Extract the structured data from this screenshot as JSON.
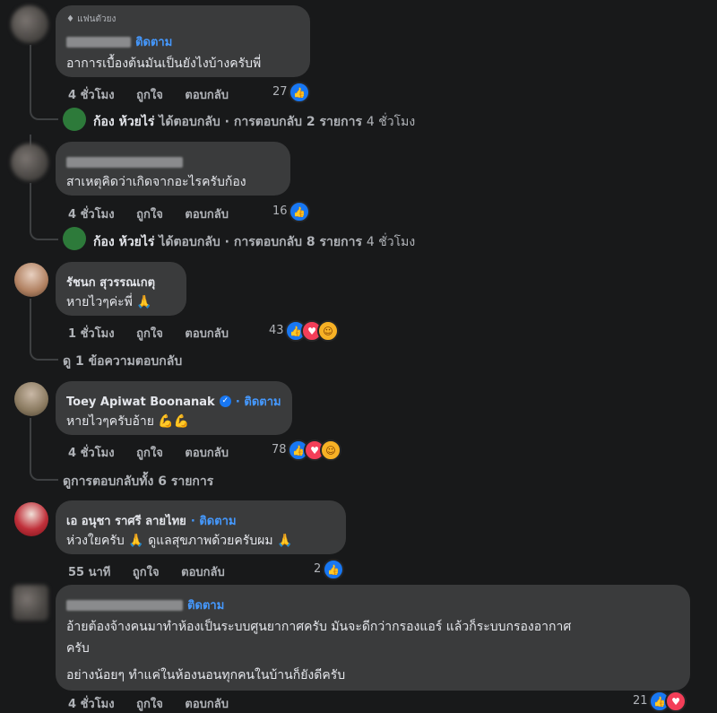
{
  "comments": [
    {
      "badge": "แฟนตัวยง",
      "follow": "ติดตาม",
      "text": "อาการเบื้องต้นมันเป็นยังไงบ้างครับพี่",
      "time": "4 ชั่วโมง",
      "like": "ถูกใจ",
      "reply": "ตอบกลับ",
      "count": "27",
      "replies_summary": {
        "name": "ก้อง ห้วยไร่",
        "action": "ได้ตอบกลับ",
        "detail": "· การตอบกลับ 2 รายการ",
        "time": "4 ชั่วโมง"
      }
    },
    {
      "text": "สาเหตุคิดว่าเกิดจากอะไรครับก้อง",
      "time": "4 ชั่วโมง",
      "like": "ถูกใจ",
      "reply": "ตอบกลับ",
      "count": "16",
      "replies_summary": {
        "name": "ก้อง ห้วยไร่",
        "action": "ได้ตอบกลับ",
        "detail": "· การตอบกลับ 8 รายการ",
        "time": "4 ชั่วโมง"
      }
    },
    {
      "name": "รัชนก สุวรรณเกตุ",
      "text": "หายไวๆค่ะพี่ 🙏",
      "time": "1 ชั่วโมง",
      "like": "ถูกใจ",
      "reply": "ตอบกลับ",
      "count": "43",
      "view_replies": "ดู 1 ข้อความตอบกลับ"
    },
    {
      "name": "Toey Apiwat Boonanak",
      "follow": "· ติดตาม",
      "text": "หายไวๆครับอ้าย 💪💪",
      "time": "4 ชั่วโมง",
      "like": "ถูกใจ",
      "reply": "ตอบกลับ",
      "count": "78",
      "view_replies": "ดูการตอบกลับทั้ง 6 รายการ"
    },
    {
      "name": "เอ อนุชา ราศรี ลายไทย",
      "follow": "· ติดตาม",
      "text": "ห่วงใยครับ 🙏 ดูแลสุขภาพด้วยครับผม 🙏",
      "time": "55 นาที",
      "like": "ถูกใจ",
      "reply": "ตอบกลับ",
      "count": "2"
    },
    {
      "follow": "ติดตาม",
      "text_line1": "อ้ายต้องจ้างคนมาทำห้องเป็นระบบศูนยากาศครับ มันจะดีกว่ากรองแอร์ แล้วก็ระบบกรองอากาศ",
      "text_line2": "ครับ",
      "text_line3": "อย่างน้อยๆ ทำแค่ในห้องนอนทุกคนในบ้านก็ยังดีครับ",
      "time": "4 ชั่วโมง",
      "like": "ถูกใจ",
      "reply": "ตอบกลับ",
      "count": "21"
    }
  ],
  "colors": {
    "bg": "#18191a",
    "bubble": "#3a3b3c",
    "link": "#4599ff",
    "like": "#1877f2"
  }
}
